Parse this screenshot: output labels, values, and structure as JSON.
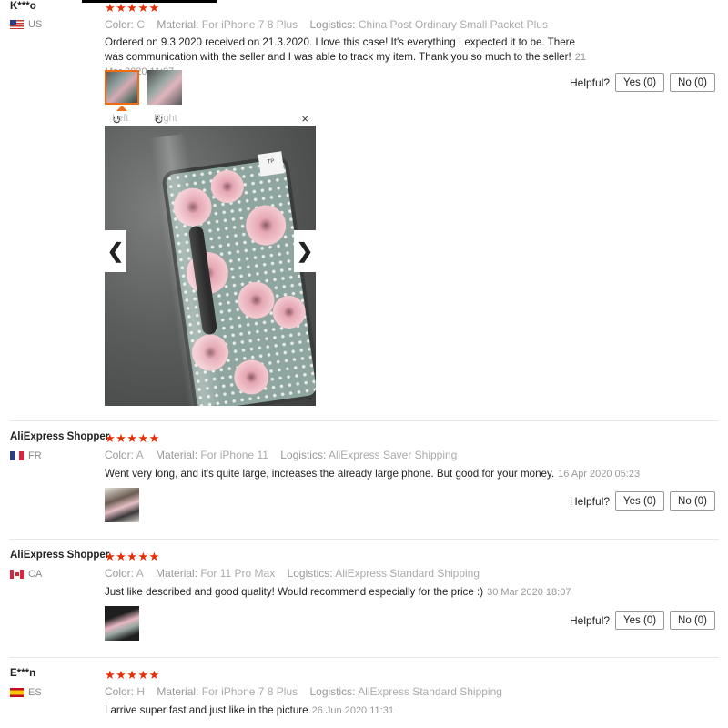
{
  "reviews": [
    {
      "user": "K***o",
      "country": "US",
      "stars": "★★★★★",
      "color_label": "Color:",
      "color": "C",
      "material_label": "Material:",
      "material": "For iPhone 7 8 Plus",
      "logistics_label": "Logistics:",
      "logistics": "China Post Ordinary Small Packet Plus",
      "text": "Ordered on 9.3.2020 received on 21.3.2020. I love this case! It's everything I expected it to be. There was communication with the seller and I was able to track my item. Thank you so much to the seller!",
      "date": "21 Mar 2020 11:27",
      "helpful_label": "Helpful?",
      "yes": "Yes (0)",
      "no": "No (0)"
    },
    {
      "user": "AliExpress Shopper",
      "country": "FR",
      "stars": "★★★★★",
      "color_label": "Color:",
      "color": "A",
      "material_label": "Material:",
      "material": "For iPhone 11",
      "logistics_label": "Logistics:",
      "logistics": "AliExpress Saver Shipping",
      "text": "Went very long, and it's quite large, increases the already large phone. But good for your money.",
      "date": "16 Apr 2020 05:23",
      "helpful_label": "Helpful?",
      "yes": "Yes (0)",
      "no": "No (0)"
    },
    {
      "user": "AliExpress Shopper",
      "country": "CA",
      "stars": "★★★★★",
      "color_label": "Color:",
      "color": "A",
      "material_label": "Material:",
      "material": "For 11 Pro Max",
      "logistics_label": "Logistics:",
      "logistics": "AliExpress Standard Shipping",
      "text": "Just like described and good quality! Would recommend especially for the price :)",
      "date": "30 Mar 2020 18:07",
      "helpful_label": "Helpful?",
      "yes": "Yes (0)",
      "no": "No (0)"
    },
    {
      "user": "E***n",
      "country": "ES",
      "stars": "★★★★★",
      "color_label": "Color:",
      "color": "H",
      "material_label": "Material:",
      "material": "For iPhone 7 8 Plus",
      "logistics_label": "Logistics:",
      "logistics": "AliExpress Standard Shipping",
      "text": "I arrive super fast and just like in the picture",
      "date": "26 Jun 2020 11:31"
    }
  ],
  "viewer": {
    "left_label": "Left",
    "right_label": "Right",
    "close": "×",
    "prev": "❮",
    "next": "❯",
    "tag_text": "TP"
  },
  "colors": {
    "star": "#e62e04",
    "thumb_selected": "#ef6c14",
    "muted": "#999999"
  }
}
